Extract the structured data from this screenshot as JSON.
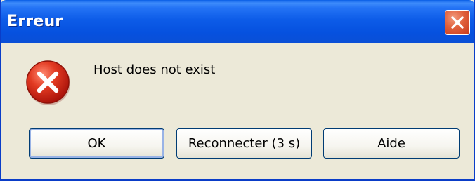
{
  "window": {
    "title": "Erreur",
    "close_icon": "close-icon"
  },
  "dialog": {
    "icon": "error-icon",
    "message": "Host does not exist"
  },
  "buttons": {
    "ok_label": "OK",
    "reconnect_label": "Reconnecter (3 s)",
    "help_label": "Aide"
  },
  "colors": {
    "titlebar": "#0a5fe6",
    "dialog_background": "#ece9d8",
    "close_button": "#e0603c",
    "error_icon": "#d42a1a"
  }
}
